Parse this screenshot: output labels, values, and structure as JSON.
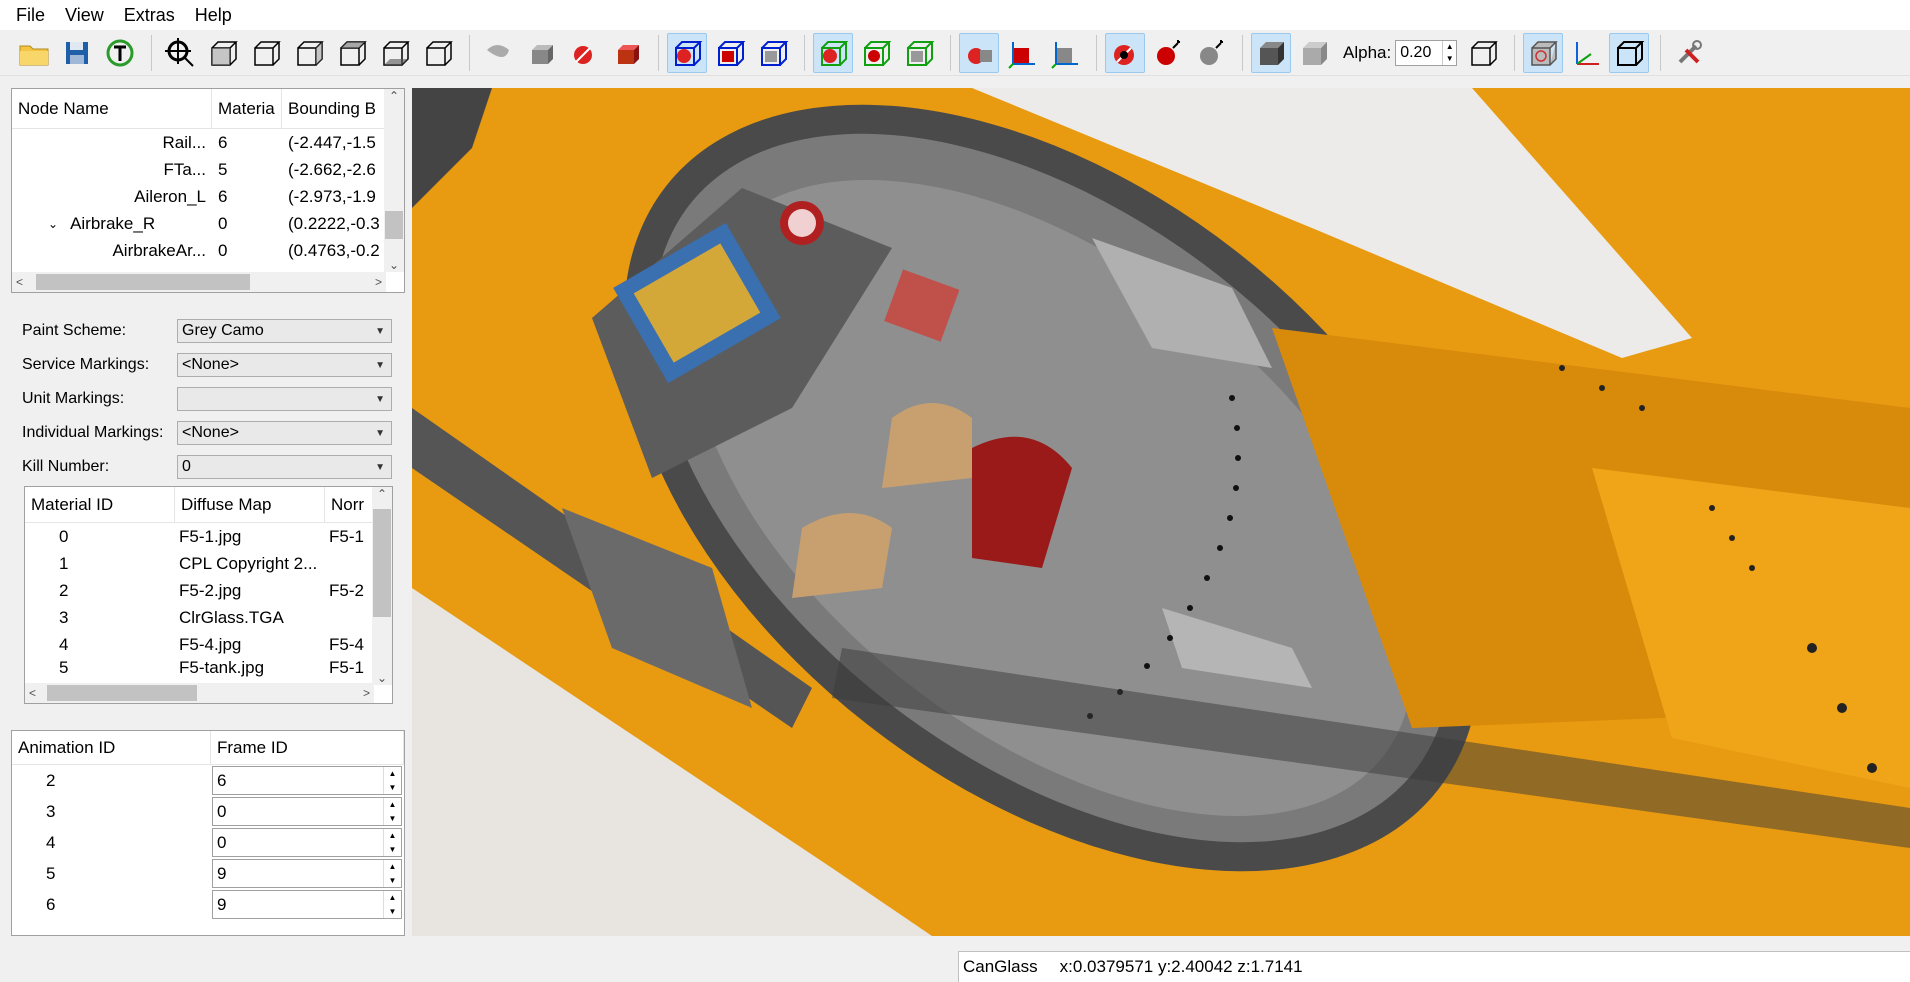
{
  "menu": [
    "File",
    "View",
    "Extras",
    "Help"
  ],
  "toolbar": {
    "alpha_label": "Alpha:",
    "alpha_value": "0.20"
  },
  "node_tree": {
    "columns": [
      "Node Name",
      "Materia",
      "Bounding B"
    ],
    "rows": [
      {
        "name": "Rail...",
        "material": "6",
        "bounds": "(-2.447,-1.5"
      },
      {
        "name": "FTa...",
        "material": "5",
        "bounds": "(-2.662,-2.6"
      },
      {
        "name": "Aileron_L",
        "material": "6",
        "bounds": "(-2.973,-1.9"
      },
      {
        "name": "Airbrake_R",
        "material": "0",
        "bounds": "(0.2222,-0.3"
      },
      {
        "name": "AirbrakeAr...",
        "material": "0",
        "bounds": "(0.4763,-0.2"
      }
    ]
  },
  "properties": [
    {
      "label": "Paint Scheme:",
      "value": "Grey Camo"
    },
    {
      "label": "Service Markings:",
      "value": "<None>"
    },
    {
      "label": "Unit Markings:",
      "value": ""
    },
    {
      "label": "Individual Markings:",
      "value": "<None>"
    },
    {
      "label": "Kill Number:",
      "value": "0"
    }
  ],
  "materials": {
    "columns": [
      "Material ID",
      "Diffuse Map",
      "Norr"
    ],
    "rows": [
      {
        "id": "0",
        "diffuse": "F5-1.jpg",
        "normal": "F5-1"
      },
      {
        "id": "1",
        "diffuse": "CPL Copyright 2...",
        "normal": ""
      },
      {
        "id": "2",
        "diffuse": "F5-2.jpg",
        "normal": "F5-2"
      },
      {
        "id": "3",
        "diffuse": "ClrGlass.TGA",
        "normal": ""
      },
      {
        "id": "4",
        "diffuse": "F5-4.jpg",
        "normal": "F5-4"
      },
      {
        "id": "5",
        "diffuse": "F5-tank.jpg",
        "normal": "F5-1"
      }
    ]
  },
  "animations": {
    "columns": [
      "Animation ID",
      "Frame ID"
    ],
    "rows": [
      {
        "id": "2",
        "frame": "6"
      },
      {
        "id": "3",
        "frame": "0"
      },
      {
        "id": "4",
        "frame": "0"
      },
      {
        "id": "5",
        "frame": "9"
      },
      {
        "id": "6",
        "frame": "9"
      }
    ]
  },
  "status": {
    "node": "CanGlass",
    "coords": "x:0.0379571 y:2.40042 z:1.7141"
  },
  "colors": {
    "fuselage": "#f0a010",
    "canopy_frame": "#4a4a4a",
    "cockpit_grey": "#8c8c8c",
    "seat_red": "#9a1a1a",
    "active_button": "#cce4f7"
  }
}
